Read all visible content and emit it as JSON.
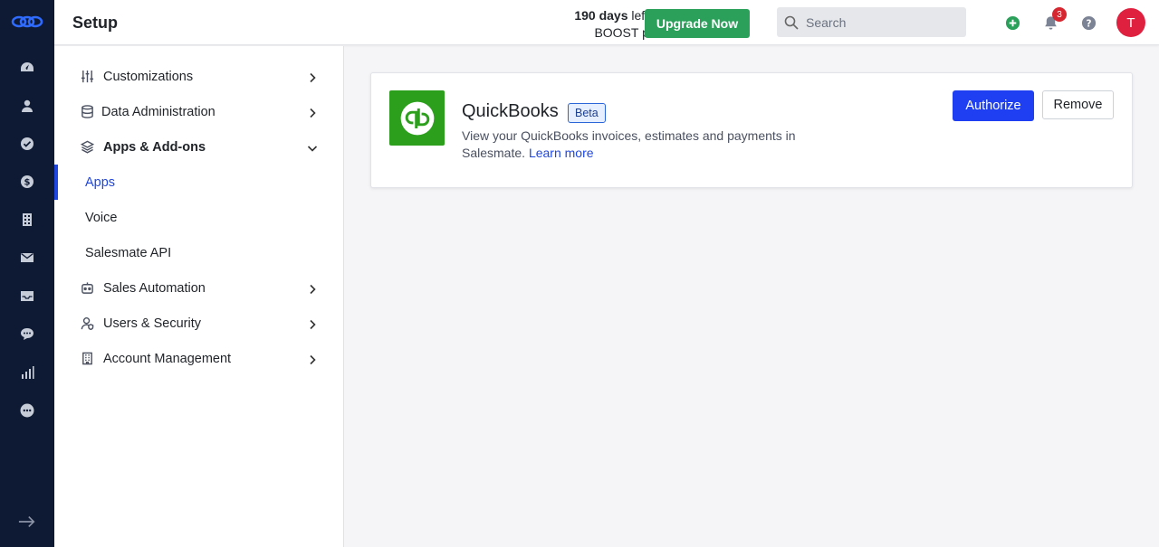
{
  "header": {
    "title": "Setup",
    "trial_days": "190 days",
    "trial_rest": " left in your",
    "trial_line2": "BOOST plan trial",
    "upgrade_label": "Upgrade Now",
    "search_placeholder": "Search",
    "notification_count": "3",
    "avatar_initial": "T"
  },
  "sidebar": {
    "items": [
      {
        "label": "Customizations"
      },
      {
        "label": "Data Administration"
      },
      {
        "label": "Apps & Add-ons"
      },
      {
        "label": "Sales Automation"
      },
      {
        "label": "Users & Security"
      },
      {
        "label": "Account Management"
      }
    ],
    "sub_items": [
      {
        "label": "Apps"
      },
      {
        "label": "Voice"
      },
      {
        "label": "Salesmate API"
      }
    ]
  },
  "app_card": {
    "name": "QuickBooks",
    "badge": "Beta",
    "description": "View your QuickBooks invoices, estimates and payments in Salesmate.",
    "learn_more": "Learn more",
    "authorize_label": "Authorize",
    "remove_label": "Remove"
  },
  "colors": {
    "rail_bg": "#0e1a33",
    "accent_blue": "#1f3ff2",
    "upgrade_green": "#2aa05a",
    "quickbooks_green": "#2ca01c",
    "avatar_red": "#e0203f"
  }
}
